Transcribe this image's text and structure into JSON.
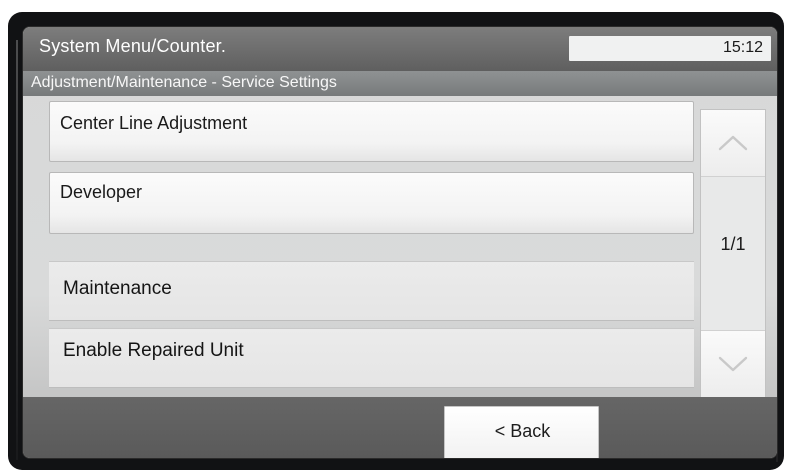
{
  "header": {
    "title": "System Menu/Counter.",
    "time": "15:12"
  },
  "subheader": {
    "title": "Adjustment/Maintenance - Service Settings"
  },
  "menu": {
    "items": [
      {
        "label": "Center Line Adjustment"
      },
      {
        "label": "Developer"
      },
      {
        "label": "Maintenance"
      },
      {
        "label": "Enable Repaired Unit"
      }
    ]
  },
  "pager": {
    "indicator": "1/1",
    "up_icon": "chevron-up-icon",
    "down_icon": "chevron-down-icon"
  },
  "footer": {
    "back_label": "< Back"
  }
}
